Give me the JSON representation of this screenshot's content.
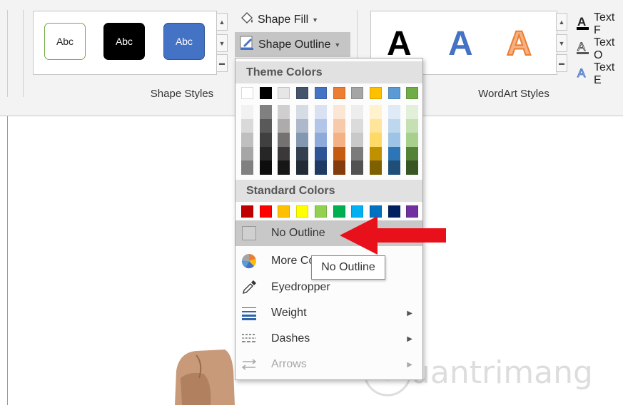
{
  "ribbon": {
    "shape_styles_label": "Shape Styles",
    "wordart_styles_label": "WordArt Styles",
    "style_swatches": [
      {
        "label": "Abc",
        "fill": "#ffffff",
        "border": "#70ad47",
        "text": "#222222"
      },
      {
        "label": "Abc",
        "fill": "#000000",
        "border": "#000000",
        "text": "#ffffff"
      },
      {
        "label": "Abc",
        "fill": "#4472c4",
        "border": "#2f5597",
        "text": "#ffffff"
      }
    ],
    "shape_fill_label": "Shape Fill",
    "shape_outline_label": "Shape Outline",
    "wordart_letters": [
      {
        "char": "A",
        "color": "#000000"
      },
      {
        "char": "A",
        "color": "#4472c4"
      },
      {
        "char": "A",
        "color": "#f4b183"
      }
    ],
    "text_commands": [
      "Text F",
      "Text O",
      "Text E"
    ]
  },
  "menu": {
    "theme_colors_label": "Theme Colors",
    "theme_base": [
      "#ffffff",
      "#000000",
      "#e7e6e6",
      "#44546a",
      "#4472c4",
      "#ed7d31",
      "#a5a5a5",
      "#ffc000",
      "#5b9bd5",
      "#70ad47"
    ],
    "theme_shades": [
      [
        "#f2f2f2",
        "#d9d9d9",
        "#bfbfbf",
        "#a6a6a6",
        "#808080"
      ],
      [
        "#808080",
        "#595959",
        "#404040",
        "#262626",
        "#0d0d0d"
      ],
      [
        "#d0cece",
        "#aeabab",
        "#757171",
        "#3a3838",
        "#171616"
      ],
      [
        "#d6dce4",
        "#adb9ca",
        "#8497b0",
        "#333f4f",
        "#222a35"
      ],
      [
        "#d9e2f3",
        "#b4c6e7",
        "#8eaadb",
        "#2f5496",
        "#1f3864"
      ],
      [
        "#fbe5d5",
        "#f7caac",
        "#f4b183",
        "#c55a11",
        "#833c0b"
      ],
      [
        "#ededed",
        "#dbdbdb",
        "#c9c9c9",
        "#7b7b7b",
        "#525252"
      ],
      [
        "#fff2cc",
        "#fee599",
        "#ffd965",
        "#bf9000",
        "#7f6000"
      ],
      [
        "#deebf6",
        "#bdd7ee",
        "#9dc3e6",
        "#2e75b5",
        "#1f4e79"
      ],
      [
        "#e2efd9",
        "#c5e0b3",
        "#a8d08d",
        "#538135",
        "#375623"
      ]
    ],
    "standard_colors_label": "Standard Colors",
    "standard_colors": [
      "#c00000",
      "#ff0000",
      "#ffc000",
      "#ffff00",
      "#92d050",
      "#00b050",
      "#00b0f0",
      "#0070c0",
      "#002060",
      "#7030a0"
    ],
    "no_outline_label": "No Outline",
    "more_colors_label": "More Colors...",
    "eyedropper_label": "Eyedropper",
    "weight_label": "Weight",
    "dashes_label": "Dashes",
    "arrows_label": "Arrows"
  },
  "tooltip": {
    "text": "No Outline"
  },
  "accent": {
    "arrow_red": "#e8101a"
  }
}
